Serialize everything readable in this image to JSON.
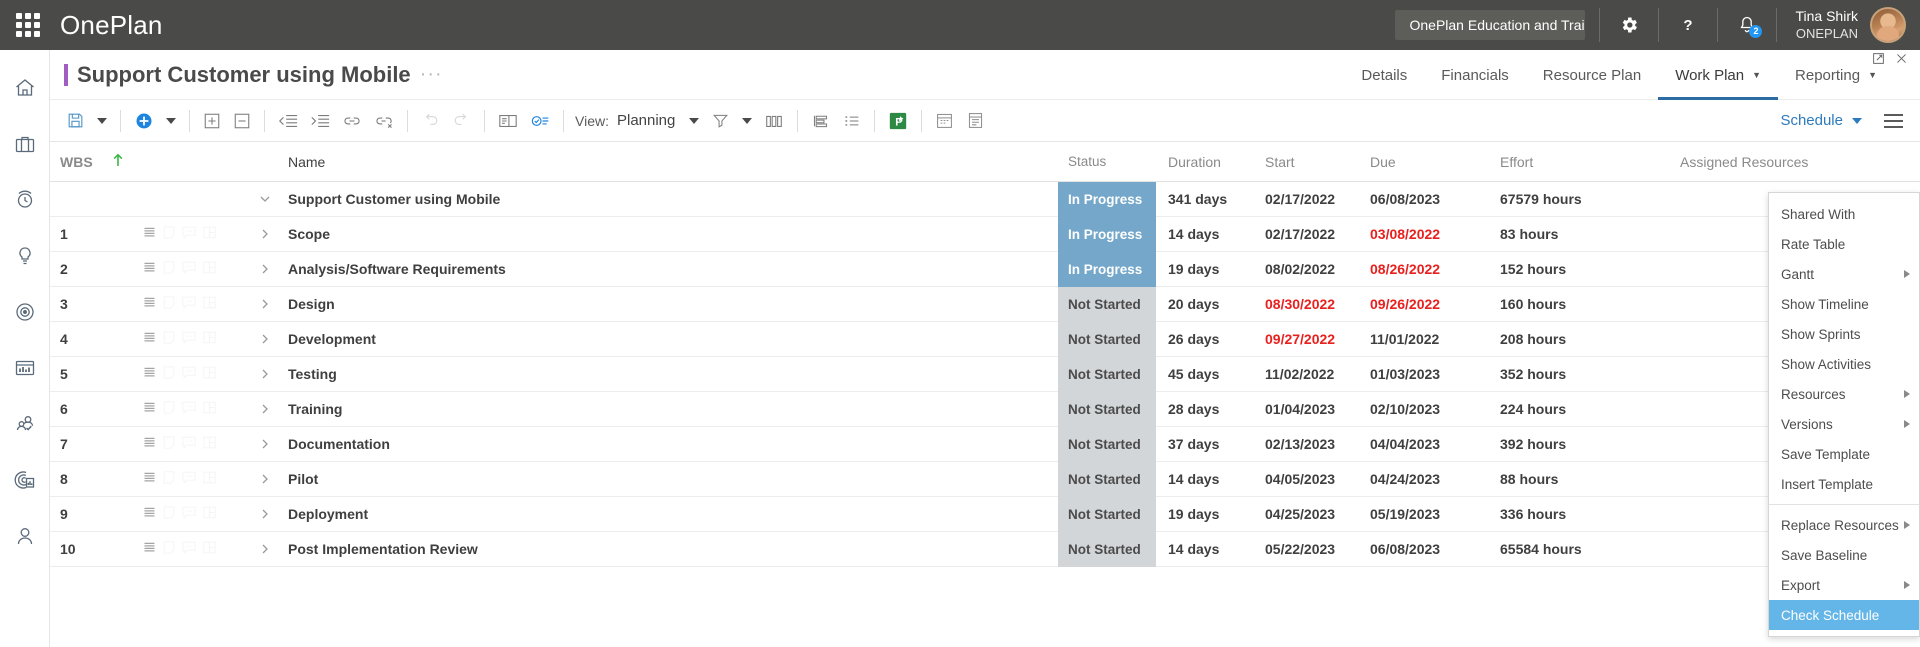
{
  "topbar": {
    "waffle_icon": "app-launcher-icon",
    "brand": "OnePlan",
    "tenant": "OnePlan Education and Training",
    "settings_icon": "gear-icon",
    "help_icon": "question-mark-icon",
    "notifications_icon": "bell-icon",
    "notification_count": "2",
    "user_name": "Tina Shirk",
    "user_org": "ONEPLAN",
    "avatar_icon": "avatar",
    "bg_color": "#4a4a48"
  },
  "rail": {
    "items": [
      {
        "icon": "home-icon",
        "label": "Home"
      },
      {
        "icon": "briefcase-icon",
        "label": "Portfolios"
      },
      {
        "icon": "clock-icon",
        "label": "Timesheets"
      },
      {
        "icon": "lightbulb-icon",
        "label": "Ideas"
      },
      {
        "icon": "target-icon",
        "label": "Strategy"
      },
      {
        "icon": "chart-icon",
        "label": "Reports"
      },
      {
        "icon": "people-check-icon",
        "label": "Resources"
      },
      {
        "icon": "insights-icon",
        "label": "Insights"
      },
      {
        "icon": "person-icon",
        "label": "Profile"
      }
    ]
  },
  "title": {
    "text": "Support Customer using Mobile",
    "ellipsis": "···",
    "accent_color": "#a05fc0",
    "popout_icon": "popout-icon",
    "close_icon": "close-icon"
  },
  "nav": {
    "tabs": [
      {
        "label": "Details",
        "active": false,
        "caret": false
      },
      {
        "label": "Financials",
        "active": false,
        "caret": false
      },
      {
        "label": "Resource Plan",
        "active": false,
        "caret": false
      },
      {
        "label": "Work Plan",
        "active": true,
        "caret": true
      },
      {
        "label": "Reporting",
        "active": false,
        "caret": true
      }
    ]
  },
  "toolbar": {
    "save_icon": "save-icon",
    "save_caret_icon": "chevron-down-icon",
    "add_icon": "add-circle-icon",
    "add_caret_icon": "chevron-down-icon",
    "expand_all_icon": "expand-plus-icon",
    "collapse_all_icon": "collapse-minus-icon",
    "outdent_icon": "outdent-icon",
    "indent_icon": "indent-icon",
    "link_icon": "link-icon",
    "unlink_icon": "unlink-icon",
    "undo_icon": "undo-icon",
    "redo_icon": "redo-icon",
    "details_pane_icon": "details-pane-icon",
    "assign_icon": "check-list-icon",
    "view_label": "View:",
    "view_value": "Planning",
    "view_caret_icon": "chevron-down-icon",
    "filter_icon": "filter-icon",
    "filter_caret_icon": "chevron-down-icon",
    "columns_icon": "columns-icon",
    "group_icon": "group-icon",
    "outline_icon": "outline-icon",
    "project_icon": "ms-project-icon",
    "calendar_icon": "calendar-icon",
    "timephased_icon": "timephased-icon",
    "schedule_label": "Schedule",
    "schedule_caret_icon": "chevron-down-icon",
    "hamburger_icon": "hamburger-menu-icon"
  },
  "menu": {
    "items": [
      {
        "label": "Shared With",
        "submenu": false,
        "selected": false,
        "sep_after": false
      },
      {
        "label": "Rate Table",
        "submenu": false,
        "selected": false,
        "sep_after": false
      },
      {
        "label": "Gantt",
        "submenu": true,
        "selected": false,
        "sep_after": false
      },
      {
        "label": "Show Timeline",
        "submenu": false,
        "selected": false,
        "sep_after": false
      },
      {
        "label": "Show Sprints",
        "submenu": false,
        "selected": false,
        "sep_after": false
      },
      {
        "label": "Show Activities",
        "submenu": false,
        "selected": false,
        "sep_after": false
      },
      {
        "label": "Resources",
        "submenu": true,
        "selected": false,
        "sep_after": false
      },
      {
        "label": "Versions",
        "submenu": true,
        "selected": false,
        "sep_after": false
      },
      {
        "label": "Save Template",
        "submenu": false,
        "selected": false,
        "sep_after": false
      },
      {
        "label": "Insert Template",
        "submenu": false,
        "selected": false,
        "sep_after": true
      },
      {
        "label": "Replace Resources",
        "submenu": true,
        "selected": false,
        "sep_after": false
      },
      {
        "label": "Save Baseline",
        "submenu": false,
        "selected": false,
        "sep_after": false
      },
      {
        "label": "Export",
        "submenu": true,
        "selected": false,
        "sep_after": false
      },
      {
        "label": "Check Schedule",
        "submenu": false,
        "selected": true,
        "sep_after": false
      }
    ],
    "highlight_color": "#64b5e8"
  },
  "grid": {
    "columns": {
      "wbs": "WBS",
      "sort_icon": "sort-ascending-icon",
      "name": "Name",
      "status": "Status",
      "duration": "Duration",
      "start": "Start",
      "due": "Due",
      "effort": "Effort",
      "assigned_resources": "Assigned Resources"
    },
    "row_icons": {
      "notes": "notes-icon",
      "attachment": "attachment-icon",
      "comment": "comment-icon",
      "board": "board-icon"
    },
    "status_colors": {
      "In Progress": "#74a7c9",
      "Not Started": "#d2d6d9"
    },
    "late_color": "#e8201e",
    "rows": [
      {
        "wbs": "",
        "name": "Support Customer using Mobile",
        "summary": true,
        "expanded": true,
        "status": "In Progress",
        "duration": "341 days",
        "start": "02/17/2022",
        "start_late": false,
        "due": "06/08/2023",
        "due_late": false,
        "effort": "67579 hours",
        "resources": ""
      },
      {
        "wbs": "1",
        "name": "Scope",
        "summary": false,
        "expanded": false,
        "status": "In Progress",
        "duration": "14 days",
        "start": "02/17/2022",
        "start_late": false,
        "due": "03/08/2022",
        "due_late": true,
        "effort": "83 hours",
        "resources": ""
      },
      {
        "wbs": "2",
        "name": "Analysis/Software Requirements",
        "summary": false,
        "expanded": false,
        "status": "In Progress",
        "duration": "19 days",
        "start": "08/02/2022",
        "start_late": false,
        "due": "08/26/2022",
        "due_late": true,
        "effort": "152 hours",
        "resources": ""
      },
      {
        "wbs": "3",
        "name": "Design",
        "summary": false,
        "expanded": false,
        "status": "Not Started",
        "duration": "20 days",
        "start": "08/30/2022",
        "start_late": true,
        "due": "09/26/2022",
        "due_late": true,
        "effort": "160 hours",
        "resources": ""
      },
      {
        "wbs": "4",
        "name": "Development",
        "summary": false,
        "expanded": false,
        "status": "Not Started",
        "duration": "26 days",
        "start": "09/27/2022",
        "start_late": true,
        "due": "11/01/2022",
        "due_late": false,
        "effort": "208 hours",
        "resources": ""
      },
      {
        "wbs": "5",
        "name": "Testing",
        "summary": false,
        "expanded": false,
        "status": "Not Started",
        "duration": "45 days",
        "start": "11/02/2022",
        "start_late": false,
        "due": "01/03/2023",
        "due_late": false,
        "effort": "352 hours",
        "resources": ""
      },
      {
        "wbs": "6",
        "name": "Training",
        "summary": false,
        "expanded": false,
        "status": "Not Started",
        "duration": "28 days",
        "start": "01/04/2023",
        "start_late": false,
        "due": "02/10/2023",
        "due_late": false,
        "effort": "224 hours",
        "resources": ""
      },
      {
        "wbs": "7",
        "name": "Documentation",
        "summary": false,
        "expanded": false,
        "status": "Not Started",
        "duration": "37 days",
        "start": "02/13/2023",
        "start_late": false,
        "due": "04/04/2023",
        "due_late": false,
        "effort": "392 hours",
        "resources": ""
      },
      {
        "wbs": "8",
        "name": "Pilot",
        "summary": false,
        "expanded": false,
        "status": "Not Started",
        "duration": "14 days",
        "start": "04/05/2023",
        "start_late": false,
        "due": "04/24/2023",
        "due_late": false,
        "effort": "88 hours",
        "resources": ""
      },
      {
        "wbs": "9",
        "name": "Deployment",
        "summary": false,
        "expanded": false,
        "status": "Not Started",
        "duration": "19 days",
        "start": "04/25/2023",
        "start_late": false,
        "due": "05/19/2023",
        "due_late": false,
        "effort": "336 hours",
        "resources": ""
      },
      {
        "wbs": "10",
        "name": "Post Implementation Review",
        "summary": false,
        "expanded": false,
        "status": "Not Started",
        "duration": "14 days",
        "start": "05/22/2023",
        "start_late": false,
        "due": "06/08/2023",
        "due_late": false,
        "effort": "65584 hours",
        "resources": ""
      }
    ]
  }
}
